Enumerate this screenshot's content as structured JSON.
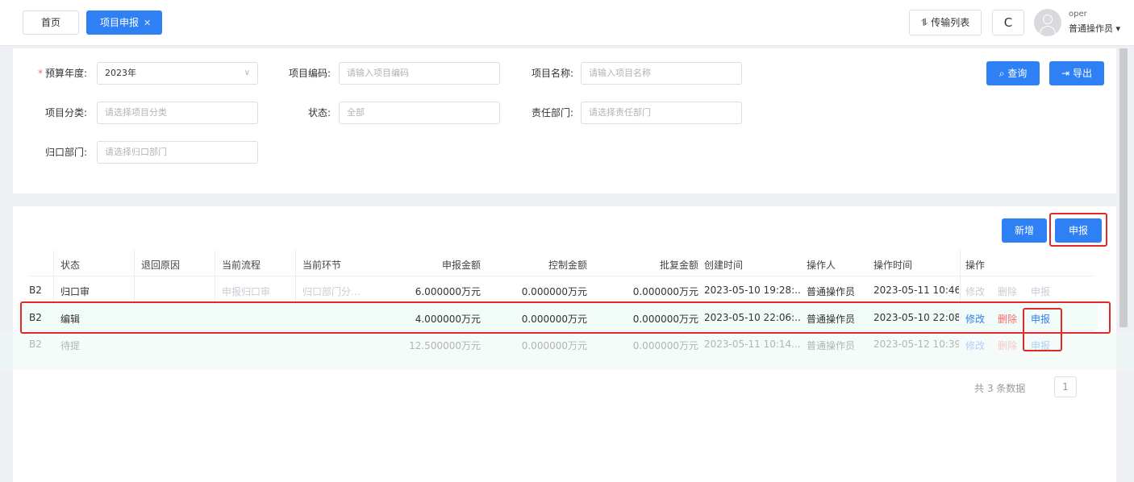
{
  "tabs": {
    "home": "首页",
    "active": "项目申报",
    "close_glyph": "✕"
  },
  "header": {
    "transfer_label": "传输列表",
    "transfer_icon": "⥮",
    "refresh_icon": "C",
    "user_name": "oper",
    "user_role": "普通操作员"
  },
  "filters": {
    "budget_year": {
      "label": "预算年度:",
      "value": "2023年"
    },
    "project_code": {
      "label": "项目编码:",
      "placeholder": "请输入项目编码"
    },
    "project_name": {
      "label": "项目名称:",
      "placeholder": "请输入项目名称"
    },
    "category": {
      "label": "项目分类:",
      "placeholder": "请选择项目分类"
    },
    "status": {
      "label": "状态:",
      "value": "全部"
    },
    "resp_dept": {
      "label": "责任部门:",
      "placeholder": "请选择责任部门"
    },
    "owner_dept": {
      "label": "归口部门:",
      "placeholder": "请选择归口部门"
    },
    "query_label": "查询",
    "export_label": "导出"
  },
  "toolbar": {
    "add_label": "新增",
    "declare_label": "申报"
  },
  "table": {
    "columns": [
      "状态",
      "退回原因",
      "当前流程",
      "当前环节",
      "申报金额",
      "控制金额",
      "批复金额",
      "创建时间",
      "操作人",
      "操作时间",
      "操作"
    ],
    "rows": [
      {
        "id": "B2",
        "status": "归口审",
        "reason": "",
        "flow": "申报归口审",
        "node": "归口部门分…",
        "declared": "6.000000万元",
        "control": "0.000000万元",
        "approved": "0.000000万元",
        "created": "2023-05-10 19:28:...",
        "operator": "普通操作员",
        "op_time": "2023-05-11 10:46:...",
        "actions": [
          "修改",
          "删除",
          "申报"
        ]
      },
      {
        "id": "B2",
        "status": "编辑",
        "reason": "",
        "flow": "",
        "node": "",
        "declared": "4.000000万元",
        "control": "0.000000万元",
        "approved": "0.000000万元",
        "created": "2023-05-10 22:06:...",
        "operator": "普通操作员",
        "op_time": "2023-05-10 22:08:...",
        "actions": [
          "修改",
          "删除",
          "申报"
        ]
      },
      {
        "id": "B2",
        "status": "待提",
        "reason": "",
        "flow": "",
        "node": "",
        "declared": "12.500000万元",
        "control": "0.000000万元",
        "approved": "0.000000万元",
        "created": "2023-05-11 10:14...",
        "operator": "普通操作员",
        "op_time": "2023-05-12 10:39...",
        "actions": [
          "修改",
          "删除",
          "申报"
        ]
      }
    ]
  },
  "pager": {
    "total_text": "共 3 条数据",
    "page": "1"
  }
}
